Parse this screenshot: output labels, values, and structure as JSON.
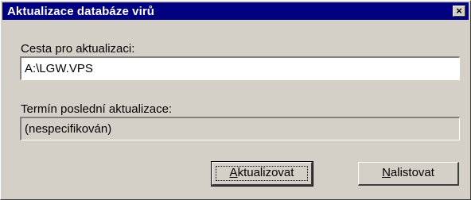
{
  "window": {
    "title": "Aktualizace databáze virů",
    "close_glyph": "×"
  },
  "form": {
    "path_label": "Cesta pro aktualizaci:",
    "path_value": "A:\\LGW.VPS",
    "last_update_label": "Termín poslední aktualizace:",
    "last_update_value": "(nespecifikován)"
  },
  "buttons": {
    "update": {
      "mnemonic": "A",
      "rest": "ktualizovat"
    },
    "browse": {
      "mnemonic": "N",
      "rest": "alistovat"
    }
  }
}
